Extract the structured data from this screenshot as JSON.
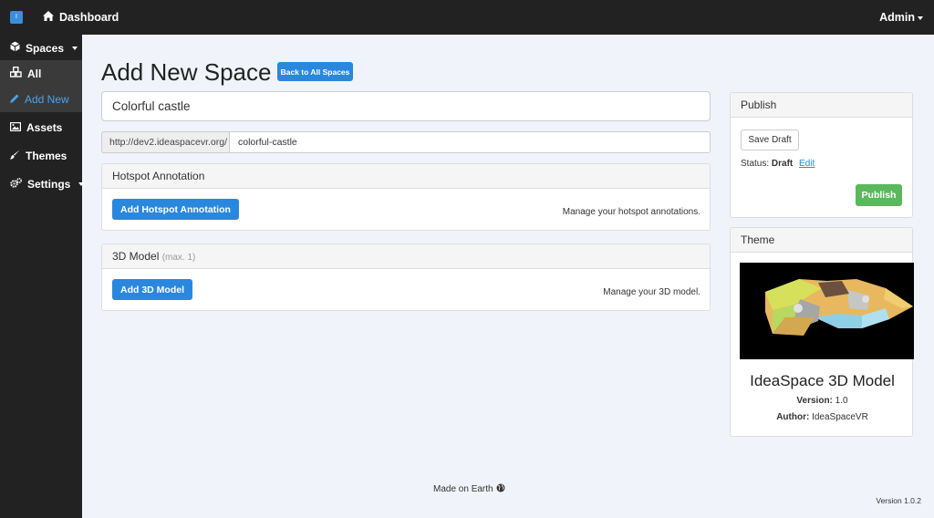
{
  "topbar": {
    "dashboard_label": "Dashboard",
    "admin_label": "Admin",
    "logo_glyph": "I"
  },
  "sidebar": {
    "spaces_label": "Spaces",
    "all_label": "All",
    "add_new_label": "Add New",
    "assets_label": "Assets",
    "themes_label": "Themes",
    "settings_label": "Settings",
    "active_color": "#4aa3e8"
  },
  "page": {
    "title": "Add New Space",
    "back_label": "Back to All Spaces"
  },
  "form": {
    "title_value": "Colorful castle",
    "url_prefix": "http://dev2.ideaspacevr.org/",
    "url_slug": "colorful-castle"
  },
  "hotspot": {
    "heading": "Hotspot Annotation",
    "button_label": "Add Hotspot Annotation",
    "note": "Manage your hotspot annotations."
  },
  "model": {
    "heading": "3D Model",
    "heading_note": "(max. 1)",
    "button_label": "Add 3D Model",
    "note": "Manage your 3D model."
  },
  "publish": {
    "heading": "Publish",
    "draft_label": "Save Draft",
    "status_label": "Status:",
    "status_value": "Draft",
    "edit_label": "Edit",
    "publish_label": "Publish",
    "publish_color": "#5cb85c"
  },
  "theme": {
    "heading": "Theme",
    "name": "IdeaSpace 3D Model",
    "version_label": "Version:",
    "version_value": "1.0",
    "author_label": "Author:",
    "author_value": "IdeaSpaceVR"
  },
  "footer": {
    "made_label": "Made on Earth",
    "version": "Version 1.0.2"
  },
  "colors": {
    "primary": "#2a87de",
    "nav_bg": "#222222",
    "page_bg": "#f0f4fa"
  }
}
